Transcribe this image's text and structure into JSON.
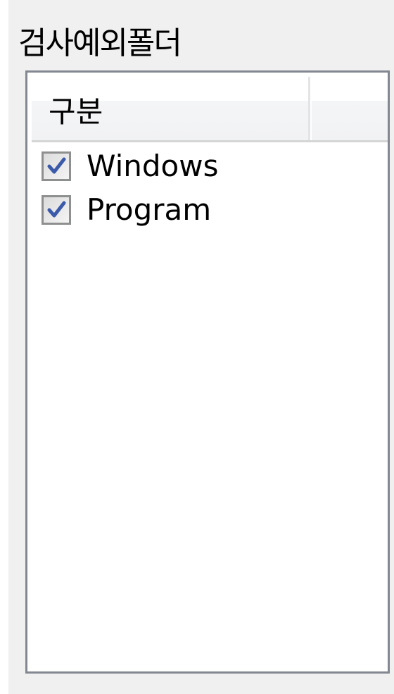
{
  "group": {
    "title": "검사예외폴더"
  },
  "list": {
    "columns": [
      {
        "label": "구분"
      }
    ],
    "items": [
      {
        "label": "Windows",
        "checked": true
      },
      {
        "label": "Program",
        "checked": true
      }
    ]
  },
  "colors": {
    "panel_bg": "#f0f0f0",
    "list_border": "#828790",
    "check_mark": "#3b5aaa"
  }
}
